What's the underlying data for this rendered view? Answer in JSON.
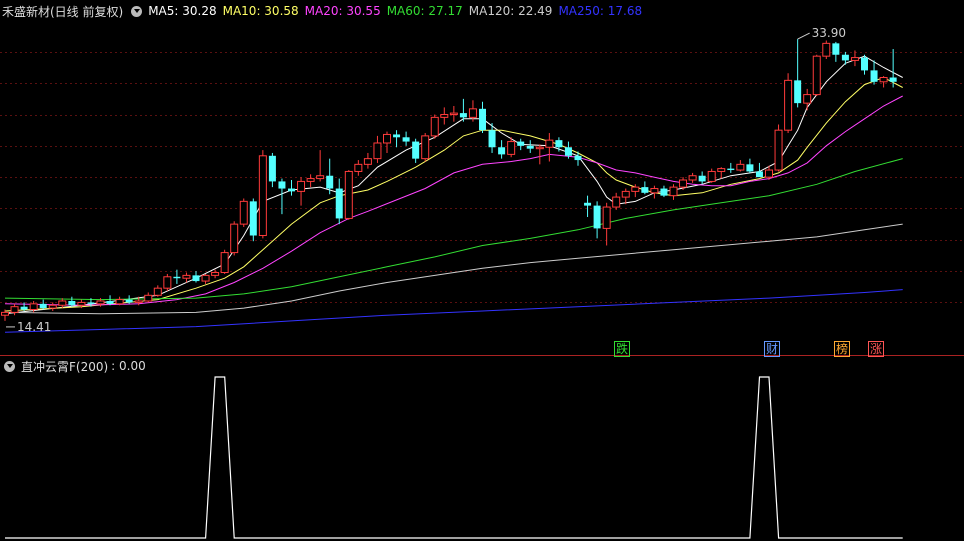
{
  "header": {
    "stock": "禾盛新材(日线 前复权)",
    "ma": [
      {
        "text": "MA5: 30.28",
        "color": "#ffffff"
      },
      {
        "text": "MA10: 30.58",
        "color": "#ffff66"
      },
      {
        "text": "MA20: 30.55",
        "color": "#ff44ff"
      },
      {
        "text": "MA60: 27.17",
        "color": "#33dd33"
      },
      {
        "text": "MA120: 22.49",
        "color": "#cccccc"
      },
      {
        "text": "MA250: 17.68",
        "color": "#3333ff"
      }
    ]
  },
  "indicator": {
    "title": "直冲云霄F(200)",
    "value": ": 0.00"
  },
  "signals": [
    {
      "label": "跌",
      "color": "#33dd33"
    },
    {
      "label": "财",
      "color": "#6699ff"
    },
    {
      "label": "榜",
      "color": "#ffaa33"
    },
    {
      "label": "涨",
      "color": "#ff5555"
    }
  ],
  "chart_data": {
    "type": "candlestick",
    "annotations": {
      "high": "33.90",
      "low": "14.41"
    },
    "ylim": [
      13.0,
      35.2
    ],
    "candles": [
      [
        14.6,
        15.0,
        14.2,
        14.8
      ],
      [
        14.8,
        15.4,
        14.6,
        15.2
      ],
      [
        15.2,
        15.5,
        14.9,
        15.0
      ],
      [
        15.0,
        15.6,
        14.8,
        15.4
      ],
      [
        15.4,
        15.7,
        15.0,
        15.1
      ],
      [
        15.1,
        15.5,
        14.9,
        15.3
      ],
      [
        15.3,
        15.8,
        15.1,
        15.6
      ],
      [
        15.6,
        15.9,
        15.2,
        15.3
      ],
      [
        15.3,
        15.7,
        15.1,
        15.5
      ],
      [
        15.5,
        15.8,
        15.2,
        15.4
      ],
      [
        15.4,
        15.8,
        15.2,
        15.6
      ],
      [
        15.6,
        16.0,
        15.3,
        15.4
      ],
      [
        15.4,
        15.9,
        15.3,
        15.7
      ],
      [
        15.7,
        16.0,
        15.4,
        15.5
      ],
      [
        15.5,
        15.9,
        15.3,
        15.6
      ],
      [
        15.6,
        16.2,
        15.5,
        16.0
      ],
      [
        16.0,
        16.7,
        15.9,
        16.5
      ],
      [
        16.5,
        17.5,
        16.3,
        17.3
      ],
      [
        17.3,
        17.8,
        16.8,
        17.2
      ],
      [
        17.2,
        17.6,
        16.9,
        17.4
      ],
      [
        17.4,
        17.7,
        16.9,
        17.0
      ],
      [
        17.0,
        17.5,
        16.8,
        17.4
      ],
      [
        17.4,
        17.8,
        17.2,
        17.6
      ],
      [
        17.6,
        19.2,
        17.5,
        19.0
      ],
      [
        19.0,
        21.2,
        18.8,
        21.0
      ],
      [
        21.0,
        22.8,
        20.8,
        22.6
      ],
      [
        22.6,
        22.8,
        19.8,
        20.2
      ],
      [
        20.2,
        26.2,
        20.0,
        25.8
      ],
      [
        25.8,
        26.0,
        23.6,
        24.0
      ],
      [
        24.0,
        24.2,
        21.7,
        23.5
      ],
      [
        23.5,
        24.1,
        23.0,
        23.3
      ],
      [
        23.3,
        24.3,
        22.3,
        24.0
      ],
      [
        24.0,
        24.5,
        23.6,
        24.2
      ],
      [
        24.2,
        26.2,
        24.0,
        24.4
      ],
      [
        24.4,
        25.6,
        23.1,
        23.5
      ],
      [
        23.5,
        24.2,
        21.0,
        21.4
      ],
      [
        21.4,
        24.8,
        21.3,
        24.7
      ],
      [
        24.7,
        25.5,
        24.4,
        25.2
      ],
      [
        25.2,
        26.0,
        24.9,
        25.6
      ],
      [
        25.6,
        27.2,
        25.3,
        26.7
      ],
      [
        26.7,
        27.5,
        26.0,
        27.3
      ],
      [
        27.3,
        27.6,
        26.4,
        27.1
      ],
      [
        27.1,
        27.5,
        26.5,
        26.8
      ],
      [
        26.8,
        27.0,
        25.3,
        25.6
      ],
      [
        25.6,
        27.4,
        25.4,
        27.2
      ],
      [
        27.2,
        28.7,
        27.0,
        28.5
      ],
      [
        28.5,
        29.2,
        28.0,
        28.7
      ],
      [
        28.7,
        29.3,
        28.2,
        28.8
      ],
      [
        28.8,
        29.8,
        28.2,
        28.5
      ],
      [
        28.5,
        29.7,
        28.2,
        29.1
      ],
      [
        29.1,
        29.6,
        27.4,
        27.6
      ],
      [
        27.6,
        28.1,
        26.0,
        26.4
      ],
      [
        26.4,
        26.9,
        25.6,
        25.9
      ],
      [
        25.9,
        27.1,
        25.7,
        26.8
      ],
      [
        26.8,
        27.0,
        26.2,
        26.5
      ],
      [
        26.5,
        26.9,
        26.0,
        26.3
      ],
      [
        26.3,
        26.6,
        25.2,
        26.4
      ],
      [
        26.4,
        27.4,
        25.4,
        26.9
      ],
      [
        26.9,
        27.1,
        26.1,
        26.4
      ],
      [
        26.4,
        26.8,
        25.6,
        25.8
      ],
      [
        25.8,
        26.1,
        25.1,
        25.5
      ],
      [
        22.5,
        23.0,
        21.5,
        22.3
      ],
      [
        22.3,
        22.6,
        20.0,
        20.7
      ],
      [
        20.7,
        22.5,
        19.5,
        22.2
      ],
      [
        22.2,
        23.2,
        22.0,
        22.9
      ],
      [
        22.9,
        23.5,
        22.4,
        23.3
      ],
      [
        23.3,
        23.8,
        22.9,
        23.6
      ],
      [
        23.6,
        24.0,
        23.1,
        23.2
      ],
      [
        23.2,
        23.7,
        22.8,
        23.5
      ],
      [
        23.5,
        23.7,
        22.9,
        23.0
      ],
      [
        23.0,
        23.8,
        22.7,
        23.6
      ],
      [
        23.6,
        24.3,
        23.4,
        24.1
      ],
      [
        24.1,
        24.6,
        23.9,
        24.4
      ],
      [
        24.4,
        24.7,
        23.8,
        24.0
      ],
      [
        24.0,
        24.9,
        23.9,
        24.7
      ],
      [
        24.7,
        25.0,
        24.2,
        24.9
      ],
      [
        24.9,
        25.3,
        24.6,
        24.8
      ],
      [
        24.8,
        25.5,
        24.7,
        25.2
      ],
      [
        25.2,
        25.6,
        24.6,
        24.7
      ],
      [
        24.7,
        25.3,
        24.5,
        24.3
      ],
      [
        24.3,
        25.1,
        24.1,
        24.8
      ],
      [
        24.8,
        28.0,
        24.7,
        27.6
      ],
      [
        27.6,
        31.6,
        27.4,
        31.1
      ],
      [
        31.1,
        34.0,
        29.2,
        29.5
      ],
      [
        29.5,
        30.5,
        29.0,
        30.1
      ],
      [
        30.1,
        32.9,
        30.0,
        32.8
      ],
      [
        32.8,
        33.9,
        32.6,
        33.7
      ],
      [
        33.7,
        33.8,
        32.4,
        32.9
      ],
      [
        32.9,
        33.1,
        32.2,
        32.5
      ],
      [
        32.5,
        33.2,
        32.1,
        32.7
      ],
      [
        32.7,
        32.9,
        31.5,
        31.8
      ],
      [
        31.8,
        32.5,
        30.8,
        31.0
      ],
      [
        31.0,
        31.4,
        30.6,
        31.3
      ],
      [
        31.3,
        33.3,
        30.6,
        31.0
      ]
    ],
    "ma_lines": [
      {
        "name": "MA5",
        "color": "#ffffff",
        "values": [
          [
            0,
            14.7
          ],
          [
            8,
            15.3
          ],
          [
            16,
            16.0
          ],
          [
            20,
            17.2
          ],
          [
            23,
            18.2
          ],
          [
            25,
            20.2
          ],
          [
            27,
            22.6
          ],
          [
            30,
            23.4
          ],
          [
            33,
            23.6
          ],
          [
            35,
            23.2
          ],
          [
            37,
            23.7
          ],
          [
            39,
            25.0
          ],
          [
            42,
            26.2
          ],
          [
            45,
            27.1
          ],
          [
            48,
            28.4
          ],
          [
            50,
            28.4
          ],
          [
            52,
            27.4
          ],
          [
            54,
            26.6
          ],
          [
            57,
            26.5
          ],
          [
            60,
            25.8
          ],
          [
            62,
            24.0
          ],
          [
            63,
            22.9
          ],
          [
            64,
            22.4
          ],
          [
            66,
            22.6
          ],
          [
            68,
            23.2
          ],
          [
            70,
            23.4
          ],
          [
            73,
            23.8
          ],
          [
            76,
            24.4
          ],
          [
            79,
            24.7
          ],
          [
            81,
            25.4
          ],
          [
            82,
            26.5
          ],
          [
            83,
            27.6
          ],
          [
            84,
            29.2
          ],
          [
            86,
            31.0
          ],
          [
            88,
            32.3
          ],
          [
            90,
            32.8
          ],
          [
            92,
            32.0
          ],
          [
            94,
            31.3
          ]
        ]
      },
      {
        "name": "MA10",
        "color": "#ffff66",
        "values": [
          [
            0,
            14.9
          ],
          [
            8,
            15.2
          ],
          [
            16,
            15.7
          ],
          [
            20,
            16.5
          ],
          [
            23,
            17.2
          ],
          [
            25,
            18.0
          ],
          [
            27,
            19.2
          ],
          [
            30,
            21.0
          ],
          [
            33,
            22.5
          ],
          [
            35,
            23.0
          ],
          [
            38,
            23.4
          ],
          [
            40,
            24.0
          ],
          [
            43,
            25.0
          ],
          [
            46,
            26.2
          ],
          [
            48,
            27.2
          ],
          [
            50,
            27.6
          ],
          [
            52,
            27.6
          ],
          [
            55,
            27.2
          ],
          [
            58,
            26.6
          ],
          [
            60,
            26.0
          ],
          [
            62,
            25.3
          ],
          [
            63,
            24.6
          ],
          [
            64,
            24.1
          ],
          [
            66,
            23.6
          ],
          [
            68,
            23.2
          ],
          [
            70,
            23.0
          ],
          [
            73,
            23.2
          ],
          [
            76,
            23.8
          ],
          [
            79,
            24.2
          ],
          [
            81,
            24.6
          ],
          [
            83,
            25.5
          ],
          [
            84,
            26.4
          ],
          [
            86,
            28.1
          ],
          [
            88,
            29.6
          ],
          [
            90,
            30.8
          ],
          [
            92,
            31.3
          ],
          [
            94,
            30.6
          ]
        ]
      },
      {
        "name": "MA20",
        "color": "#ff44ff",
        "values": [
          [
            0,
            15.4
          ],
          [
            8,
            15.3
          ],
          [
            14,
            15.4
          ],
          [
            18,
            15.7
          ],
          [
            21,
            16.1
          ],
          [
            24,
            16.9
          ],
          [
            27,
            17.9
          ],
          [
            30,
            19.1
          ],
          [
            33,
            20.4
          ],
          [
            36,
            21.4
          ],
          [
            38,
            21.9
          ],
          [
            41,
            22.7
          ],
          [
            44,
            23.5
          ],
          [
            47,
            24.6
          ],
          [
            50,
            25.2
          ],
          [
            53,
            25.4
          ],
          [
            55,
            25.6
          ],
          [
            57,
            25.9
          ],
          [
            60,
            25.7
          ],
          [
            62,
            25.3
          ],
          [
            64,
            24.8
          ],
          [
            66,
            24.6
          ],
          [
            68,
            24.3
          ],
          [
            70,
            24.0
          ],
          [
            72,
            23.8
          ],
          [
            74,
            23.7
          ],
          [
            76,
            23.7
          ],
          [
            78,
            24.0
          ],
          [
            80,
            24.2
          ],
          [
            82,
            24.6
          ],
          [
            84,
            25.3
          ],
          [
            86,
            26.5
          ],
          [
            88,
            27.5
          ],
          [
            90,
            28.4
          ],
          [
            92,
            29.3
          ],
          [
            94,
            30.0
          ]
        ]
      },
      {
        "name": "MA60",
        "color": "#33dd33",
        "values": [
          [
            0,
            15.8
          ],
          [
            10,
            15.7
          ],
          [
            20,
            15.8
          ],
          [
            25,
            16.1
          ],
          [
            30,
            16.6
          ],
          [
            35,
            17.3
          ],
          [
            40,
            18.0
          ],
          [
            45,
            18.7
          ],
          [
            50,
            19.5
          ],
          [
            55,
            20.0
          ],
          [
            60,
            20.6
          ],
          [
            65,
            21.4
          ],
          [
            70,
            22.0
          ],
          [
            75,
            22.5
          ],
          [
            80,
            23.0
          ],
          [
            85,
            23.8
          ],
          [
            89,
            24.7
          ],
          [
            94,
            25.6
          ]
        ]
      },
      {
        "name": "MA120",
        "color": "#cccccc",
        "values": [
          [
            0,
            14.8
          ],
          [
            10,
            14.7
          ],
          [
            20,
            14.8
          ],
          [
            25,
            15.1
          ],
          [
            30,
            15.6
          ],
          [
            35,
            16.3
          ],
          [
            40,
            16.9
          ],
          [
            45,
            17.4
          ],
          [
            50,
            17.9
          ],
          [
            55,
            18.3
          ],
          [
            60,
            18.6
          ],
          [
            65,
            18.9
          ],
          [
            70,
            19.2
          ],
          [
            75,
            19.5
          ],
          [
            80,
            19.8
          ],
          [
            85,
            20.1
          ],
          [
            90,
            20.6
          ],
          [
            94,
            21.0
          ]
        ]
      },
      {
        "name": "MA250",
        "color": "#3333ff",
        "values": [
          [
            0,
            13.4
          ],
          [
            10,
            13.6
          ],
          [
            20,
            13.8
          ],
          [
            30,
            14.2
          ],
          [
            40,
            14.6
          ],
          [
            50,
            14.9
          ],
          [
            60,
            15.2
          ],
          [
            70,
            15.5
          ],
          [
            80,
            15.8
          ],
          [
            90,
            16.2
          ],
          [
            94,
            16.4
          ]
        ]
      }
    ],
    "indicator": {
      "ylim": [
        0,
        1
      ],
      "values": [
        [
          0,
          0
        ],
        [
          21,
          0
        ],
        [
          22,
          1
        ],
        [
          23,
          1
        ],
        [
          24,
          0
        ],
        [
          78,
          0
        ],
        [
          79,
          1
        ],
        [
          80,
          1
        ],
        [
          81,
          0
        ],
        [
          94,
          0
        ]
      ]
    }
  }
}
